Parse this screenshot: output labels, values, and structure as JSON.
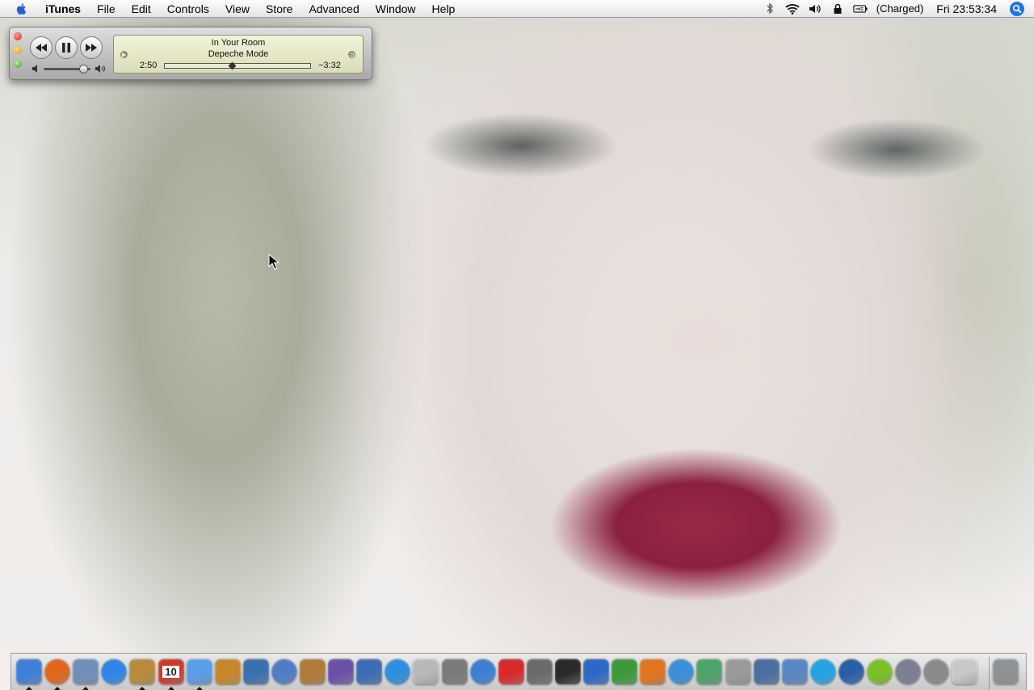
{
  "menubar": {
    "app_name": "iTunes",
    "items": [
      "File",
      "Edit",
      "Controls",
      "View",
      "Store",
      "Advanced",
      "Window",
      "Help"
    ],
    "battery_status": "(Charged)",
    "clock": "Fri 23:53:34",
    "status_icons": [
      "bluetooth-icon",
      "wifi-icon",
      "volume-icon",
      "lock-icon",
      "battery-icon"
    ]
  },
  "player": {
    "track_title": "In Your Room",
    "artist": "Depeche Mode",
    "elapsed": "2:50",
    "remaining": "−3:32",
    "progress": 0.46,
    "volume": 0.85,
    "state": "playing"
  },
  "dock": {
    "icons": [
      {
        "name": "finder",
        "color": "#3f7fd8",
        "running": true
      },
      {
        "name": "firefox",
        "color": "#e0661c",
        "running": true
      },
      {
        "name": "mail-stamp",
        "color": "#6f8fb8",
        "running": true
      },
      {
        "name": "ichat",
        "color": "#2f86e6",
        "running": false
      },
      {
        "name": "address-book",
        "color": "#b98a3a",
        "running": true
      },
      {
        "name": "ical",
        "color": "#cc3a2a",
        "running": true,
        "label": "10"
      },
      {
        "name": "itunes",
        "color": "#5a9ee8",
        "running": true
      },
      {
        "name": "photo-app",
        "color": "#c9862b",
        "running": false
      },
      {
        "name": "imovie",
        "color": "#3a6fb0",
        "running": false
      },
      {
        "name": "dvd-player",
        "color": "#4f7cc4",
        "running": false
      },
      {
        "name": "preview",
        "color": "#b07a38",
        "running": false
      },
      {
        "name": "painter",
        "color": "#6c4fa8",
        "running": false
      },
      {
        "name": "keynote",
        "color": "#3b6db5",
        "running": false
      },
      {
        "name": "quicktime",
        "color": "#2e8fe0",
        "running": false
      },
      {
        "name": "dvd-studio",
        "color": "#b8b8b8",
        "running": false
      },
      {
        "name": "garageband",
        "color": "#7a7a7a",
        "running": false
      },
      {
        "name": "safari",
        "color": "#3e7fd6",
        "running": false
      },
      {
        "name": "adobe-app",
        "color": "#d82a2a",
        "running": false
      },
      {
        "name": "disk-utility",
        "color": "#6a6a6a",
        "running": false
      },
      {
        "name": "headphones",
        "color": "#2a2a2a",
        "running": false
      },
      {
        "name": "word",
        "color": "#2b68c8",
        "running": false
      },
      {
        "name": "excel",
        "color": "#3b9b3a",
        "running": false
      },
      {
        "name": "powerpoint",
        "color": "#e0741f",
        "running": false
      },
      {
        "name": "messenger",
        "color": "#3c8fd8",
        "running": false
      },
      {
        "name": "pen-tool",
        "color": "#4ea36a",
        "running": false
      },
      {
        "name": "print-center",
        "color": "#9a9a9a",
        "running": false
      },
      {
        "name": "remote-desktop",
        "color": "#4a6fa0",
        "running": false
      },
      {
        "name": "network",
        "color": "#5b86c4",
        "running": false
      },
      {
        "name": "skype",
        "color": "#23a3e6",
        "running": false
      },
      {
        "name": "google-earth",
        "color": "#2a5fa8",
        "running": false
      },
      {
        "name": "tuner",
        "color": "#7bbf2a",
        "running": false
      },
      {
        "name": "time-machine",
        "color": "#7a8090",
        "running": false
      },
      {
        "name": "sync",
        "color": "#8a8a8a",
        "running": false
      },
      {
        "name": "apple-store",
        "color": "#c8c8c8",
        "running": false
      },
      {
        "name": "trash",
        "color": "#8d9296",
        "running": false
      }
    ]
  }
}
